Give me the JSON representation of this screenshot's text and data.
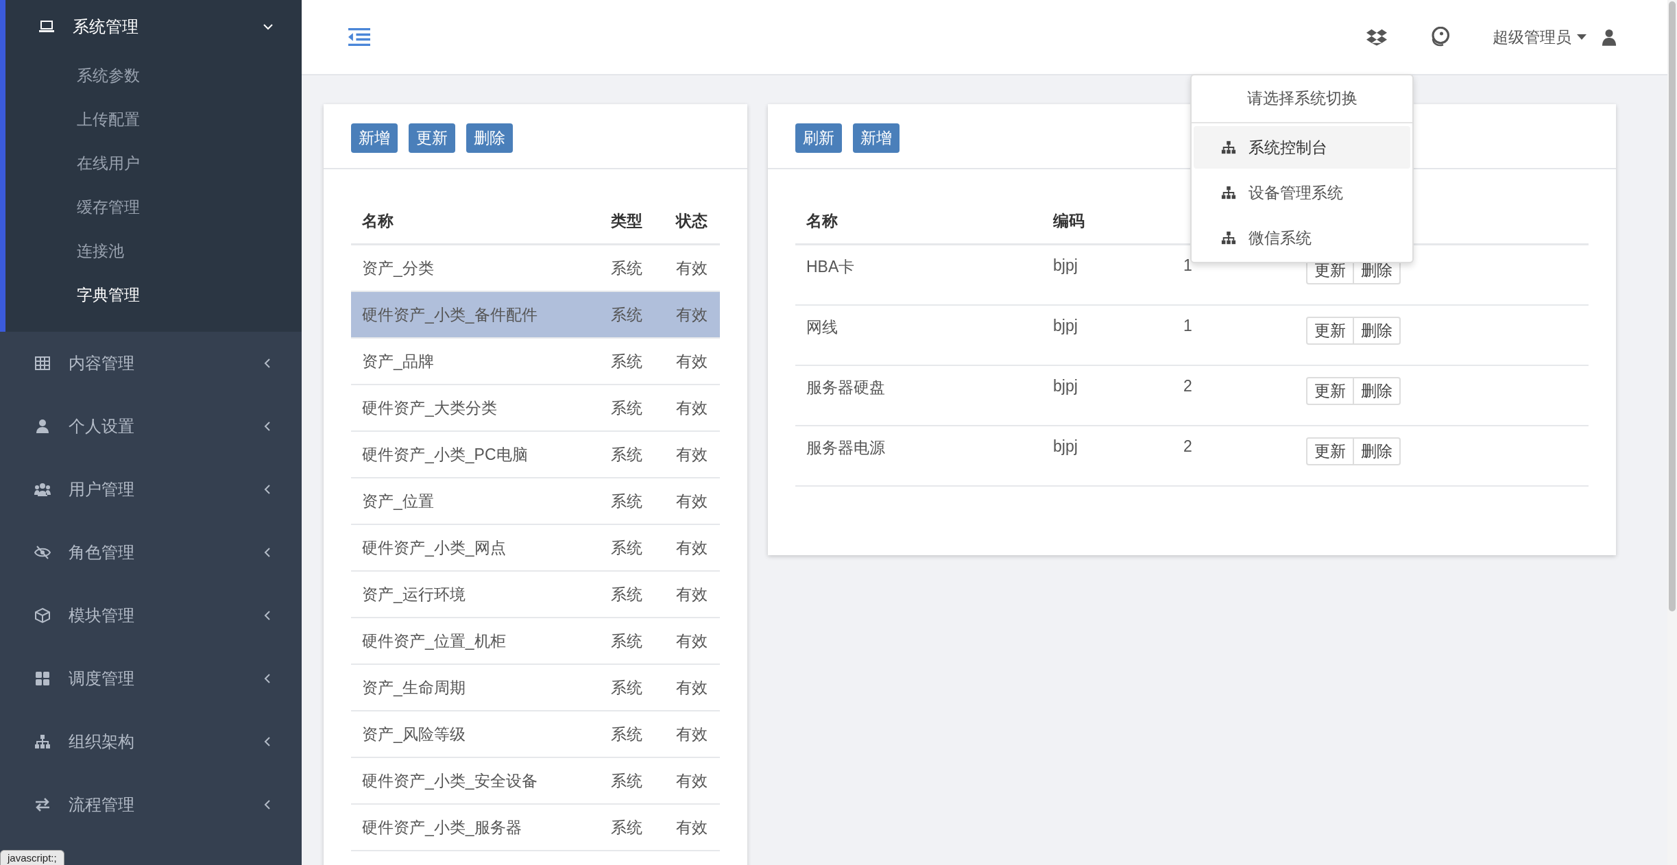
{
  "sidebar": {
    "groups": [
      {
        "label": "系统管理",
        "expanded": true,
        "children": [
          {
            "label": "系统参数",
            "selected": false
          },
          {
            "label": "上传配置",
            "selected": false
          },
          {
            "label": "在线用户",
            "selected": false
          },
          {
            "label": "缓存管理",
            "selected": false
          },
          {
            "label": "连接池",
            "selected": false
          },
          {
            "label": "字典管理",
            "selected": true
          }
        ]
      },
      {
        "label": "内容管理",
        "expanded": false
      },
      {
        "label": "个人设置",
        "expanded": false
      },
      {
        "label": "用户管理",
        "expanded": false
      },
      {
        "label": "角色管理",
        "expanded": false
      },
      {
        "label": "模块管理",
        "expanded": false
      },
      {
        "label": "调度管理",
        "expanded": false
      },
      {
        "label": "组织架构",
        "expanded": false
      },
      {
        "label": "流程管理",
        "expanded": false
      }
    ]
  },
  "header": {
    "user_name": "超级管理员"
  },
  "system_menu": {
    "title": "请选择系统切换",
    "items": [
      {
        "label": "系统控制台",
        "selected": true
      },
      {
        "label": "设备管理系统",
        "selected": false
      },
      {
        "label": "微信系统",
        "selected": false
      }
    ]
  },
  "dict_panel": {
    "buttons": [
      "新增",
      "更新",
      "删除"
    ],
    "columns": [
      "名称",
      "类型",
      "状态"
    ],
    "rows": [
      {
        "cells": [
          "资产_分类",
          "系统",
          "有效"
        ],
        "selected": false
      },
      {
        "cells": [
          "硬件资产_小类_备件配件",
          "系统",
          "有效"
        ],
        "selected": true
      },
      {
        "cells": [
          "资产_品牌",
          "系统",
          "有效"
        ],
        "selected": false
      },
      {
        "cells": [
          "硬件资产_大类分类",
          "系统",
          "有效"
        ],
        "selected": false
      },
      {
        "cells": [
          "硬件资产_小类_PC电脑",
          "系统",
          "有效"
        ],
        "selected": false
      },
      {
        "cells": [
          "资产_位置",
          "系统",
          "有效"
        ],
        "selected": false
      },
      {
        "cells": [
          "硬件资产_小类_网点",
          "系统",
          "有效"
        ],
        "selected": false
      },
      {
        "cells": [
          "资产_运行环境",
          "系统",
          "有效"
        ],
        "selected": false
      },
      {
        "cells": [
          "硬件资产_位置_机柜",
          "系统",
          "有效"
        ],
        "selected": false
      },
      {
        "cells": [
          "资产_生命周期",
          "系统",
          "有效"
        ],
        "selected": false
      },
      {
        "cells": [
          "资产_风险等级",
          "系统",
          "有效"
        ],
        "selected": false
      },
      {
        "cells": [
          "硬件资产_小类_安全设备",
          "系统",
          "有效"
        ],
        "selected": false
      },
      {
        "cells": [
          "硬件资产_小类_服务器",
          "系统",
          "有效"
        ],
        "selected": false
      }
    ]
  },
  "item_panel": {
    "buttons": [
      "刷新",
      "新增"
    ],
    "columns": [
      "名称",
      "编码"
    ],
    "rows": [
      {
        "cells": [
          "HBA卡",
          "bjpj",
          "1"
        ],
        "actions": [
          "更新",
          "删除"
        ]
      },
      {
        "cells": [
          "网线",
          "bjpj",
          "1"
        ],
        "actions": [
          "更新",
          "删除"
        ]
      },
      {
        "cells": [
          "服务器硬盘",
          "bjpj",
          "2"
        ],
        "actions": [
          "更新",
          "删除"
        ]
      },
      {
        "cells": [
          "服务器电源",
          "bjpj",
          "2"
        ],
        "actions": [
          "更新",
          "删除"
        ]
      }
    ]
  },
  "status_bubble": "javascript:;"
}
